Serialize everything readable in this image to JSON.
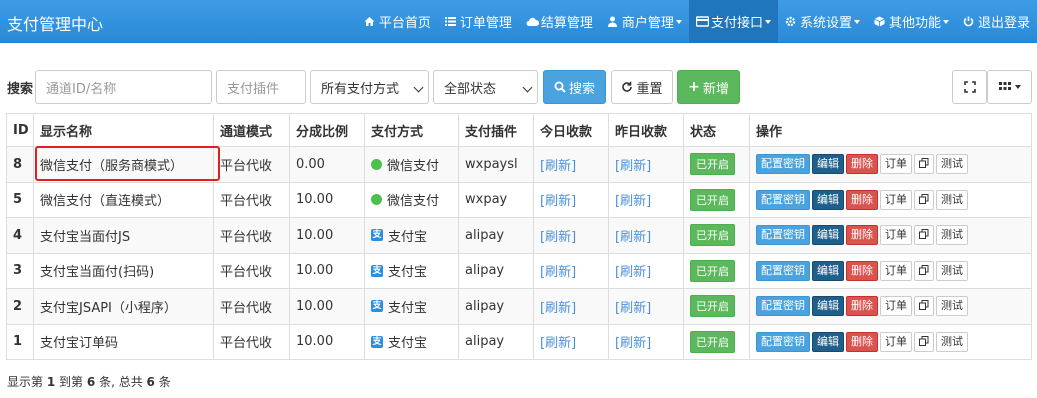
{
  "brand": "支付管理中心",
  "nav": [
    {
      "label": "平台首页",
      "icon": "home-icon",
      "caret": false,
      "active": false
    },
    {
      "label": "订单管理",
      "icon": "list-icon",
      "caret": false,
      "active": false
    },
    {
      "label": "结算管理",
      "icon": "cloud-icon",
      "caret": false,
      "active": false
    },
    {
      "label": "商户管理",
      "icon": "user-icon",
      "caret": true,
      "active": false
    },
    {
      "label": "支付接口",
      "icon": "card-icon",
      "caret": true,
      "active": true
    },
    {
      "label": "系统设置",
      "icon": "gear-icon",
      "caret": true,
      "active": false
    },
    {
      "label": "其他功能",
      "icon": "cube-icon",
      "caret": true,
      "active": false
    },
    {
      "label": "退出登录",
      "icon": "power-icon",
      "caret": false,
      "active": false
    }
  ],
  "search": {
    "label": "搜索",
    "channel_placeholder": "通道ID/名称",
    "plugin_placeholder": "支付插件",
    "method_select": "所有支付方式",
    "status_select": "全部状态",
    "search_btn": "搜索",
    "reset_btn": "重置",
    "add_btn": "新增"
  },
  "table": {
    "headers": [
      "ID",
      "显示名称",
      "通道模式",
      "分成比例",
      "支付方式",
      "支付插件",
      "今日收款",
      "昨日收款",
      "状态",
      "操作"
    ],
    "rows": [
      {
        "id": "8",
        "name": "微信支付（服务商模式）",
        "mode": "平台代收",
        "ratio": "0.00",
        "method": "微信支付",
        "method_icon": "wechat-icon",
        "plugin": "wxpaysl",
        "today": "[刷新]",
        "yesterday": "[刷新]",
        "status": "已开启"
      },
      {
        "id": "5",
        "name": "微信支付（直连模式）",
        "mode": "平台代收",
        "ratio": "10.00",
        "method": "微信支付",
        "method_icon": "wechat-icon",
        "plugin": "wxpay",
        "today": "[刷新]",
        "yesterday": "[刷新]",
        "status": "已开启"
      },
      {
        "id": "4",
        "name": "支付宝当面付JS",
        "mode": "平台代收",
        "ratio": "10.00",
        "method": "支付宝",
        "method_icon": "alipay-icon",
        "plugin": "alipay",
        "today": "[刷新]",
        "yesterday": "[刷新]",
        "status": "已开启"
      },
      {
        "id": "3",
        "name": "支付宝当面付(扫码)",
        "mode": "平台代收",
        "ratio": "10.00",
        "method": "支付宝",
        "method_icon": "alipay-icon",
        "plugin": "alipay",
        "today": "[刷新]",
        "yesterday": "[刷新]",
        "status": "已开启"
      },
      {
        "id": "2",
        "name": "支付宝JSAPI（小程序）",
        "mode": "平台代收",
        "ratio": "10.00",
        "method": "支付宝",
        "method_icon": "alipay-icon",
        "plugin": "alipay",
        "today": "[刷新]",
        "yesterday": "[刷新]",
        "status": "已开启"
      },
      {
        "id": "1",
        "name": "支付宝订单码",
        "mode": "平台代收",
        "ratio": "10.00",
        "method": "支付宝",
        "method_icon": "alipay-icon",
        "plugin": "alipay",
        "today": "[刷新]",
        "yesterday": "[刷新]",
        "status": "已开启"
      }
    ],
    "op_labels": {
      "config": "配置密钥",
      "edit": "编辑",
      "delete": "删除",
      "order": "订单",
      "test": "测试"
    }
  },
  "footer": {
    "pre": "显示第",
    "from": "1",
    "mid": "到第",
    "to": "6",
    "post": "条, 总共",
    "total": "6",
    "end": "条"
  },
  "colors": {
    "navbar": "#2a8ad7",
    "nav_active": "#1f76bd",
    "primary": "#4aa3df",
    "success": "#5cb85c",
    "danger": "#d9534f",
    "highlight": "#e02020"
  }
}
